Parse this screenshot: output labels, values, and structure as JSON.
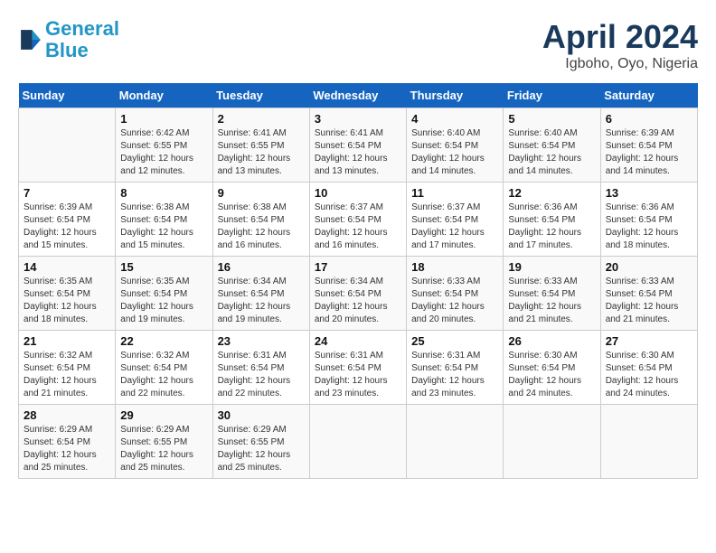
{
  "header": {
    "logo_line1": "General",
    "logo_line2": "Blue",
    "title": "April 2024",
    "subtitle": "Igboho, Oyo, Nigeria"
  },
  "days_of_week": [
    "Sunday",
    "Monday",
    "Tuesday",
    "Wednesday",
    "Thursday",
    "Friday",
    "Saturday"
  ],
  "weeks": [
    [
      {
        "day": "",
        "info": ""
      },
      {
        "day": "1",
        "info": "Sunrise: 6:42 AM\nSunset: 6:55 PM\nDaylight: 12 hours\nand 12 minutes."
      },
      {
        "day": "2",
        "info": "Sunrise: 6:41 AM\nSunset: 6:55 PM\nDaylight: 12 hours\nand 13 minutes."
      },
      {
        "day": "3",
        "info": "Sunrise: 6:41 AM\nSunset: 6:54 PM\nDaylight: 12 hours\nand 13 minutes."
      },
      {
        "day": "4",
        "info": "Sunrise: 6:40 AM\nSunset: 6:54 PM\nDaylight: 12 hours\nand 14 minutes."
      },
      {
        "day": "5",
        "info": "Sunrise: 6:40 AM\nSunset: 6:54 PM\nDaylight: 12 hours\nand 14 minutes."
      },
      {
        "day": "6",
        "info": "Sunrise: 6:39 AM\nSunset: 6:54 PM\nDaylight: 12 hours\nand 14 minutes."
      }
    ],
    [
      {
        "day": "7",
        "info": "Sunrise: 6:39 AM\nSunset: 6:54 PM\nDaylight: 12 hours\nand 15 minutes."
      },
      {
        "day": "8",
        "info": "Sunrise: 6:38 AM\nSunset: 6:54 PM\nDaylight: 12 hours\nand 15 minutes."
      },
      {
        "day": "9",
        "info": "Sunrise: 6:38 AM\nSunset: 6:54 PM\nDaylight: 12 hours\nand 16 minutes."
      },
      {
        "day": "10",
        "info": "Sunrise: 6:37 AM\nSunset: 6:54 PM\nDaylight: 12 hours\nand 16 minutes."
      },
      {
        "day": "11",
        "info": "Sunrise: 6:37 AM\nSunset: 6:54 PM\nDaylight: 12 hours\nand 17 minutes."
      },
      {
        "day": "12",
        "info": "Sunrise: 6:36 AM\nSunset: 6:54 PM\nDaylight: 12 hours\nand 17 minutes."
      },
      {
        "day": "13",
        "info": "Sunrise: 6:36 AM\nSunset: 6:54 PM\nDaylight: 12 hours\nand 18 minutes."
      }
    ],
    [
      {
        "day": "14",
        "info": "Sunrise: 6:35 AM\nSunset: 6:54 PM\nDaylight: 12 hours\nand 18 minutes."
      },
      {
        "day": "15",
        "info": "Sunrise: 6:35 AM\nSunset: 6:54 PM\nDaylight: 12 hours\nand 19 minutes."
      },
      {
        "day": "16",
        "info": "Sunrise: 6:34 AM\nSunset: 6:54 PM\nDaylight: 12 hours\nand 19 minutes."
      },
      {
        "day": "17",
        "info": "Sunrise: 6:34 AM\nSunset: 6:54 PM\nDaylight: 12 hours\nand 20 minutes."
      },
      {
        "day": "18",
        "info": "Sunrise: 6:33 AM\nSunset: 6:54 PM\nDaylight: 12 hours\nand 20 minutes."
      },
      {
        "day": "19",
        "info": "Sunrise: 6:33 AM\nSunset: 6:54 PM\nDaylight: 12 hours\nand 21 minutes."
      },
      {
        "day": "20",
        "info": "Sunrise: 6:33 AM\nSunset: 6:54 PM\nDaylight: 12 hours\nand 21 minutes."
      }
    ],
    [
      {
        "day": "21",
        "info": "Sunrise: 6:32 AM\nSunset: 6:54 PM\nDaylight: 12 hours\nand 21 minutes."
      },
      {
        "day": "22",
        "info": "Sunrise: 6:32 AM\nSunset: 6:54 PM\nDaylight: 12 hours\nand 22 minutes."
      },
      {
        "day": "23",
        "info": "Sunrise: 6:31 AM\nSunset: 6:54 PM\nDaylight: 12 hours\nand 22 minutes."
      },
      {
        "day": "24",
        "info": "Sunrise: 6:31 AM\nSunset: 6:54 PM\nDaylight: 12 hours\nand 23 minutes."
      },
      {
        "day": "25",
        "info": "Sunrise: 6:31 AM\nSunset: 6:54 PM\nDaylight: 12 hours\nand 23 minutes."
      },
      {
        "day": "26",
        "info": "Sunrise: 6:30 AM\nSunset: 6:54 PM\nDaylight: 12 hours\nand 24 minutes."
      },
      {
        "day": "27",
        "info": "Sunrise: 6:30 AM\nSunset: 6:54 PM\nDaylight: 12 hours\nand 24 minutes."
      }
    ],
    [
      {
        "day": "28",
        "info": "Sunrise: 6:29 AM\nSunset: 6:54 PM\nDaylight: 12 hours\nand 25 minutes."
      },
      {
        "day": "29",
        "info": "Sunrise: 6:29 AM\nSunset: 6:55 PM\nDaylight: 12 hours\nand 25 minutes."
      },
      {
        "day": "30",
        "info": "Sunrise: 6:29 AM\nSunset: 6:55 PM\nDaylight: 12 hours\nand 25 minutes."
      },
      {
        "day": "",
        "info": ""
      },
      {
        "day": "",
        "info": ""
      },
      {
        "day": "",
        "info": ""
      },
      {
        "day": "",
        "info": ""
      }
    ]
  ]
}
